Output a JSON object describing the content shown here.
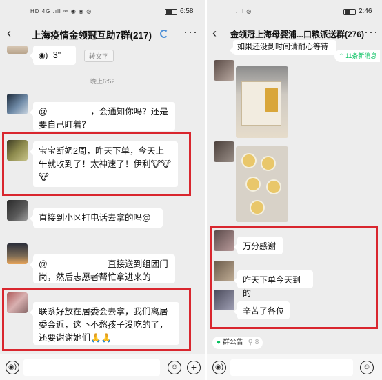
{
  "left": {
    "status": {
      "network": "HD 4G .ıll ✉ ◉ ◉ ◎",
      "time": "6:58"
    },
    "title": "上海疫情金领冠互助7群(217)",
    "voice": {
      "duration": "3\"",
      "convert_label": "转文字"
    },
    "timestamp": "晚上6:52",
    "messages": [
      {
        "text": "@　　　　　，会通知你吗？还是要自己盯着？"
      },
      {
        "text": "宝宝断奶2周，昨天下单，今天上午就收到了！太神速了！伊利🐮🐮🐮"
      },
      {
        "text": "直接到小区打电话去拿的吗@"
      },
      {
        "text": "@　　　　　　　直接送到组团门岗，然后志愿者帮忙拿进来的"
      },
      {
        "text": "联系好放在居委会去拿，我们离居委会近，这下不愁孩子没吃的了，还要谢谢她们🙏🙏"
      }
    ]
  },
  "right": {
    "status": {
      "network": ".ıll ◎",
      "time": "2:46"
    },
    "title": "金领冠上海母婴浦...口粮派送群(276)",
    "top_message": "如果还没到时间请耐心等待",
    "new_messages": "11条新消息",
    "messages": [
      {
        "text": "万分感谢"
      },
      {
        "text": "昨天下单今天到的"
      },
      {
        "text": "辛苦了各位"
      }
    ],
    "announcement": {
      "label": "群公告",
      "count": "8"
    }
  },
  "colors": {
    "highlight_border": "#d9262e",
    "chat_bg": "#ededed",
    "link_green": "#07c160"
  }
}
